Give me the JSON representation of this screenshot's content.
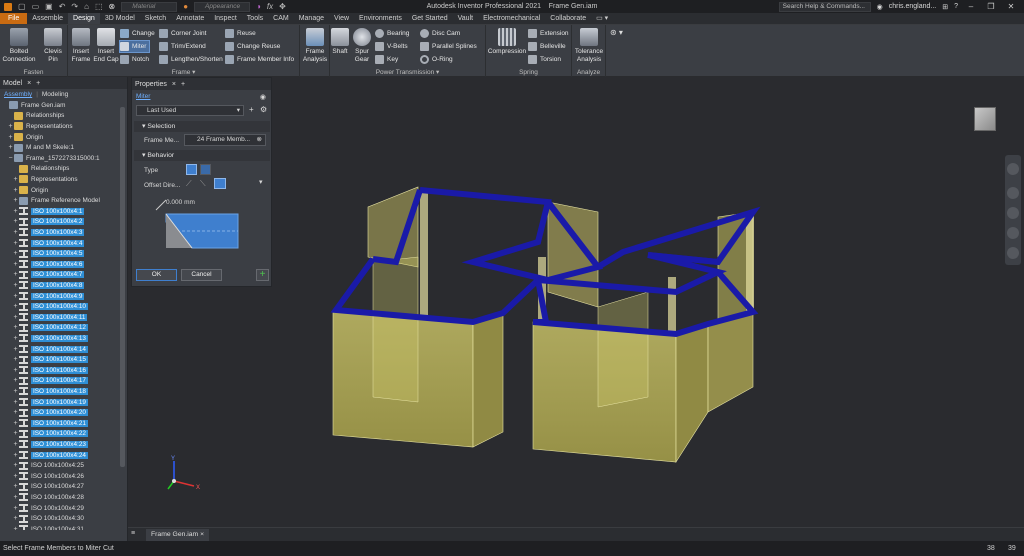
{
  "titlebar": {
    "title": "Autodesk Inventor Professional 2021",
    "doc_name": "Frame Gen.iam",
    "search_placeholder": "Search Help & Commands...",
    "user": "chris.england...",
    "material": "Material",
    "appearance": "Appearance",
    "fx": "fx"
  },
  "tabs": [
    "File",
    "Assemble",
    "Design",
    "3D Model",
    "Sketch",
    "Annotate",
    "Inspect",
    "Tools",
    "CAM",
    "Manage",
    "View",
    "Environments",
    "Get Started",
    "Vault",
    "Electromechanical",
    "Collaborate"
  ],
  "active_tab": "Design",
  "ribbon": {
    "fasten": {
      "label": "Fasten",
      "bolted": "Bolted\nConnection",
      "clevis": "Clevis\nPin"
    },
    "frame": {
      "label": "Frame",
      "insert_frame": "Insert\nFrame",
      "insert_endcap": "Insert\nEnd Cap",
      "change": "Change",
      "miter": "Miter",
      "notch": "Notch",
      "corner": "Corner Joint",
      "trim": "Trim/Extend",
      "lengthen": "Lengthen/Shorten",
      "reuse": "Reuse",
      "change_reuse": "Change Reuse",
      "member_info": "Frame Member Info"
    },
    "frame_analysis": {
      "label": "Frame\nAnalysis"
    },
    "power": {
      "label": "Power Transmission",
      "shaft": "Shaft",
      "spur": "Spur\nGear",
      "bearing": "Bearing",
      "vbelts": "V-Belts",
      "key": "Key",
      "disc": "Disc Cam",
      "splines": "Parallel Splines",
      "oring": "O-Ring"
    },
    "spring": {
      "label": "Spring",
      "compression": "Compression",
      "extension": "Extension",
      "belleville": "Belleville",
      "torsion": "Torsion"
    },
    "analyze": {
      "label": "Analyze",
      "tolerance": "Tolerance\nAnalysis"
    }
  },
  "browser": {
    "tab": "Model",
    "mode_assembly": "Assembly",
    "mode_modeling": "Modeling",
    "nodes": [
      {
        "text": "Frame Gen.iam",
        "indent": 0,
        "icon": "asm",
        "plus": "",
        "hl": false
      },
      {
        "text": "Relationships",
        "indent": 1,
        "icon": "fold",
        "plus": "",
        "hl": false
      },
      {
        "text": "Representations",
        "indent": 1,
        "icon": "fold",
        "plus": "+",
        "hl": false
      },
      {
        "text": "Origin",
        "indent": 1,
        "icon": "fold",
        "plus": "+",
        "hl": false
      },
      {
        "text": "M and M Skele:1",
        "indent": 1,
        "icon": "asm",
        "plus": "+",
        "hl": false
      },
      {
        "text": "Frame_1572273315000:1",
        "indent": 1,
        "icon": "asm",
        "plus": "−",
        "hl": false
      },
      {
        "text": "Relationships",
        "indent": 2,
        "icon": "fold",
        "plus": "",
        "hl": false
      },
      {
        "text": "Representations",
        "indent": 2,
        "icon": "fold",
        "plus": "+",
        "hl": false
      },
      {
        "text": "Origin",
        "indent": 2,
        "icon": "fold",
        "plus": "+",
        "hl": false
      },
      {
        "text": "Frame Reference Model",
        "indent": 2,
        "icon": "asm",
        "plus": "+",
        "hl": false
      },
      {
        "text": "ISO 100x100x4:1",
        "indent": 2,
        "icon": "ibeam",
        "plus": "+",
        "hl": true
      },
      {
        "text": "ISO 100x100x4:2",
        "indent": 2,
        "icon": "ibeam",
        "plus": "+",
        "hl": true
      },
      {
        "text": "ISO 100x100x4:3",
        "indent": 2,
        "icon": "ibeam",
        "plus": "+",
        "hl": true
      },
      {
        "text": "ISO 100x100x4:4",
        "indent": 2,
        "icon": "ibeam",
        "plus": "+",
        "hl": true
      },
      {
        "text": "ISO 100x100x4:5",
        "indent": 2,
        "icon": "ibeam",
        "plus": "+",
        "hl": true
      },
      {
        "text": "ISO 100x100x4:6",
        "indent": 2,
        "icon": "ibeam",
        "plus": "+",
        "hl": true
      },
      {
        "text": "ISO 100x100x4:7",
        "indent": 2,
        "icon": "ibeam",
        "plus": "+",
        "hl": true
      },
      {
        "text": "ISO 100x100x4:8",
        "indent": 2,
        "icon": "ibeam",
        "plus": "+",
        "hl": true
      },
      {
        "text": "ISO 100x100x4:9",
        "indent": 2,
        "icon": "ibeam",
        "plus": "+",
        "hl": true
      },
      {
        "text": "ISO 100x100x4:10",
        "indent": 2,
        "icon": "ibeam",
        "plus": "+",
        "hl": true
      },
      {
        "text": "ISO 100x100x4:11",
        "indent": 2,
        "icon": "ibeam",
        "plus": "+",
        "hl": true
      },
      {
        "text": "ISO 100x100x4:12",
        "indent": 2,
        "icon": "ibeam",
        "plus": "+",
        "hl": true
      },
      {
        "text": "ISO 100x100x4:13",
        "indent": 2,
        "icon": "ibeam",
        "plus": "+",
        "hl": true
      },
      {
        "text": "ISO 100x100x4:14",
        "indent": 2,
        "icon": "ibeam",
        "plus": "+",
        "hl": true
      },
      {
        "text": "ISO 100x100x4:15",
        "indent": 2,
        "icon": "ibeam",
        "plus": "+",
        "hl": true
      },
      {
        "text": "ISO 100x100x4:16",
        "indent": 2,
        "icon": "ibeam",
        "plus": "+",
        "hl": true
      },
      {
        "text": "ISO 100x100x4:17",
        "indent": 2,
        "icon": "ibeam",
        "plus": "+",
        "hl": true
      },
      {
        "text": "ISO 100x100x4:18",
        "indent": 2,
        "icon": "ibeam",
        "plus": "+",
        "hl": true
      },
      {
        "text": "ISO 100x100x4:19",
        "indent": 2,
        "icon": "ibeam",
        "plus": "+",
        "hl": true
      },
      {
        "text": "ISO 100x100x4:20",
        "indent": 2,
        "icon": "ibeam",
        "plus": "+",
        "hl": true
      },
      {
        "text": "ISO 100x100x4:21",
        "indent": 2,
        "icon": "ibeam",
        "plus": "+",
        "hl": true
      },
      {
        "text": "ISO 100x100x4:22",
        "indent": 2,
        "icon": "ibeam",
        "plus": "+",
        "hl": true
      },
      {
        "text": "ISO 100x100x4:23",
        "indent": 2,
        "icon": "ibeam",
        "plus": "+",
        "hl": true
      },
      {
        "text": "ISO 100x100x4:24",
        "indent": 2,
        "icon": "ibeam",
        "plus": "+",
        "hl": true
      },
      {
        "text": "ISO 100x100x4:25",
        "indent": 2,
        "icon": "ibeam",
        "plus": "+",
        "hl": false
      },
      {
        "text": "ISO 100x100x4:26",
        "indent": 2,
        "icon": "ibeam",
        "plus": "+",
        "hl": false
      },
      {
        "text": "ISO 100x100x4:27",
        "indent": 2,
        "icon": "ibeam",
        "plus": "+",
        "hl": false
      },
      {
        "text": "ISO 100x100x4:28",
        "indent": 2,
        "icon": "ibeam",
        "plus": "+",
        "hl": false
      },
      {
        "text": "ISO 100x100x4:29",
        "indent": 2,
        "icon": "ibeam",
        "plus": "+",
        "hl": false
      },
      {
        "text": "ISO 100x100x4:30",
        "indent": 2,
        "icon": "ibeam",
        "plus": "+",
        "hl": false
      },
      {
        "text": "ISO 100x100x4:31",
        "indent": 2,
        "icon": "ibeam",
        "plus": "+",
        "hl": false
      }
    ]
  },
  "properties": {
    "title": "Properties",
    "command": "Miter",
    "preset": "Last Used",
    "selection_header": "Selection",
    "frame_members_label": "Frame Me...",
    "frame_members_value": "24 Frame Memb...",
    "behavior_header": "Behavior",
    "type_label": "Type",
    "offset_label": "Offset Dire...",
    "offset_value": "0.000 mm",
    "ok": "OK",
    "cancel": "Cancel"
  },
  "doc_tab": "Frame Gen.iam",
  "status": {
    "text": "Select Frame Members to Miter Cut",
    "n1": "38",
    "n2": "39"
  },
  "colors": {
    "accent": "#2f8fd6",
    "frame_blue": "#1a1aa8",
    "panel_yellow": "#cfc86a",
    "file_tab": "#c96b12"
  }
}
